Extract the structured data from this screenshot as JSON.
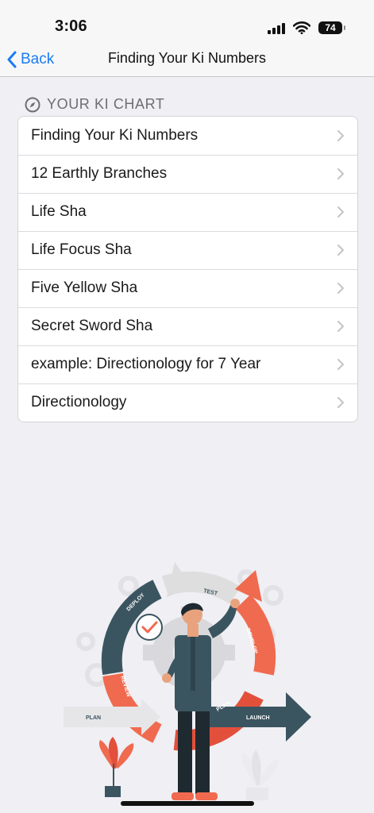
{
  "status": {
    "time": "3:06",
    "battery": "74"
  },
  "nav": {
    "back_label": "Back",
    "title": "Finding Your Ki Numbers"
  },
  "section": {
    "title": "YOUR KI CHART"
  },
  "items": [
    {
      "label": "Finding Your Ki Numbers"
    },
    {
      "label": "12 Earthly Branches"
    },
    {
      "label": "Life Sha"
    },
    {
      "label": "Life Focus Sha"
    },
    {
      "label": "Five Yellow Sha"
    },
    {
      "label": "Secret Sword Sha"
    },
    {
      "label": "example: Directionology for 7 Year"
    },
    {
      "label": "Directionology"
    }
  ],
  "illustration": {
    "labels": {
      "deploy": "DEPLOY",
      "test": "TEST",
      "develop": "DEVELOP",
      "review": "REVIEW",
      "plan": "PLAN",
      "plan_arrow": "PLAN",
      "launch": "LAUNCH"
    }
  },
  "colors": {
    "accent": "#1a7cf5",
    "coral": "#f06a4f",
    "slate": "#3b5560",
    "gray": "#dedede"
  }
}
